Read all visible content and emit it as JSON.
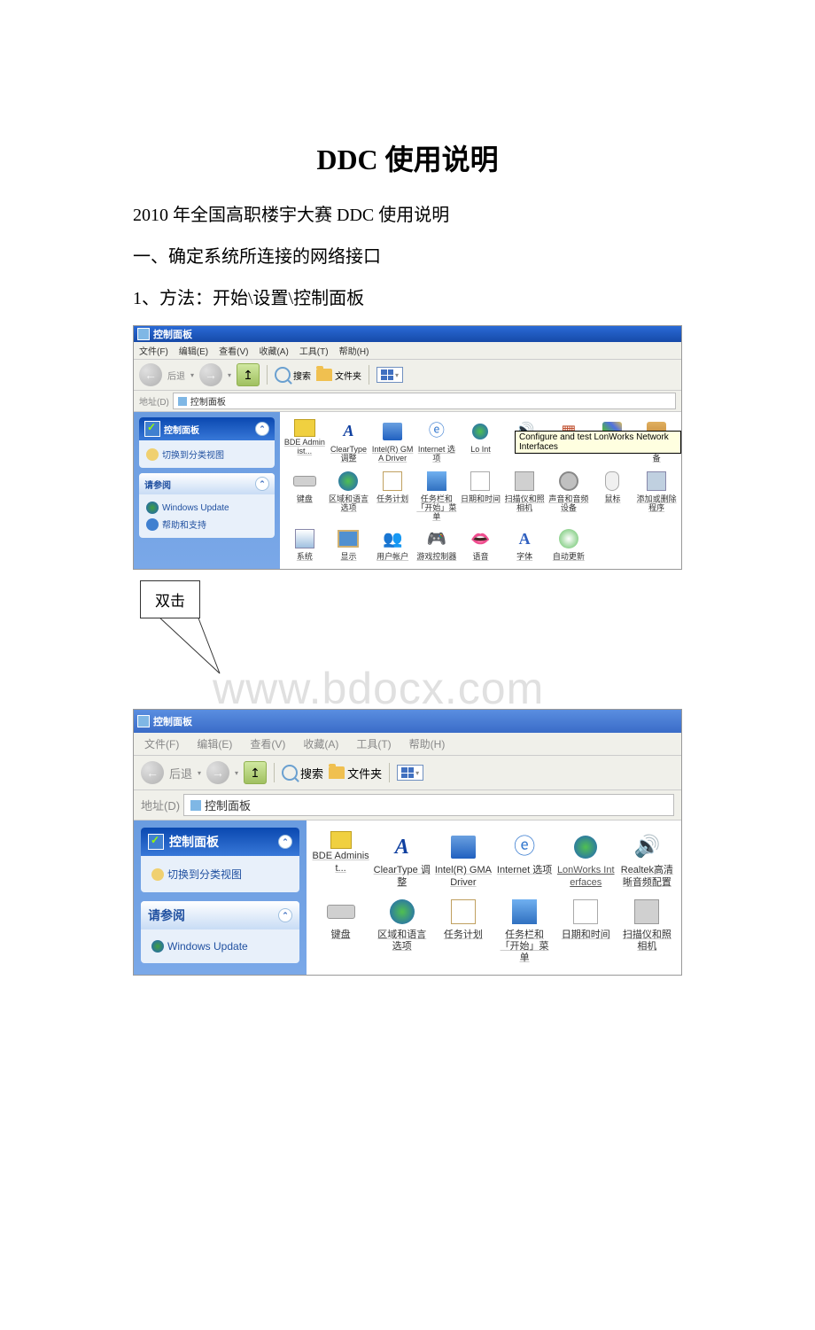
{
  "doc": {
    "title": "DDC 使用说明",
    "line1": "2010 年全国高职楼宇大赛 DDC 使用说明",
    "line2": "一、确定系统所连接的网络接口",
    "line3": "1、方法：开始\\设置\\控制面板"
  },
  "callout": {
    "text": "双击"
  },
  "watermark": "www.bdocx.com",
  "scr1": {
    "title": "控制面板",
    "menu": [
      "文件(F)",
      "编辑(E)",
      "查看(V)",
      "收藏(A)",
      "工具(T)",
      "帮助(H)"
    ],
    "toolbar": {
      "back": "后退",
      "search": "搜索",
      "folders": "文件夹"
    },
    "address": {
      "label": "地址(D)",
      "value": "控制面板"
    },
    "panels": {
      "cp": {
        "title": "控制面板",
        "switch": "切换到分类视图"
      },
      "see": {
        "title": "请参阅",
        "links": [
          "Windows Update",
          "帮助和支持"
        ]
      }
    },
    "tooltip": "Configure and test LonWorks Network Interfaces",
    "items_r1": [
      "BDE Administ...",
      "ClearType 调整",
      "Intel(R) GMA Driver",
      "Internet 选项",
      "Lo Int",
      "",
      "",
      "",
      "便携媒体设备"
    ],
    "items_r2": [
      "键盘",
      "区域和语言选项",
      "任务计划",
      "任务栏和「开始」菜单",
      "日期和时间",
      "扫描仪和照相机",
      "声音和音频设备",
      "鼠标",
      "添加或删除程序"
    ],
    "items_r3": [
      "系统",
      "显示",
      "用户帐户",
      "游戏控制器",
      "语音",
      "字体",
      "自动更新"
    ]
  },
  "scr2": {
    "title": "控制面板",
    "menu": [
      "文件(F)",
      "编辑(E)",
      "查看(V)",
      "收藏(A)",
      "工具(T)",
      "帮助(H)"
    ],
    "toolbar": {
      "back": "后退",
      "search": "搜索",
      "folders": "文件夹"
    },
    "address": {
      "label": "地址(D)",
      "value": "控制面板"
    },
    "panels": {
      "cp": {
        "title": "控制面板",
        "switch": "切换到分类视图"
      },
      "see": {
        "title": "请参阅",
        "links": [
          "Windows Update"
        ]
      }
    },
    "items_r1": [
      "BDE Administ...",
      "ClearType 调整",
      "Intel(R) GMA Driver",
      "Internet 选项",
      "LonWorks Interfaces",
      "Realtek高清晰音频配置"
    ],
    "items_r2": [
      "键盘",
      "区域和语言选项",
      "任务计划",
      "任务栏和「开始」菜单",
      "日期和时间",
      "扫描仪和照相机"
    ]
  }
}
